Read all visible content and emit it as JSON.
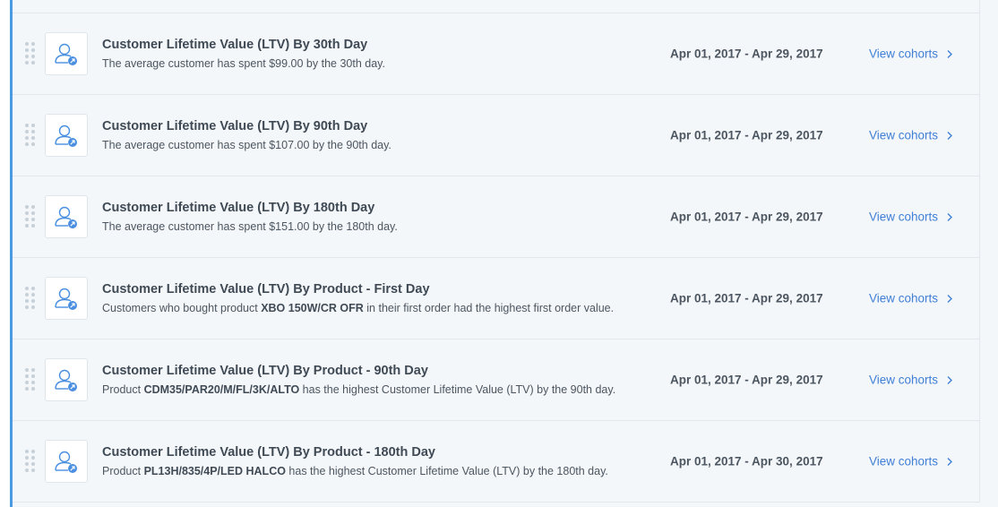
{
  "rows": [
    {
      "title": "Customer Lifetime Value (LTV) By 30th Day",
      "desc_pre": "The average customer has spent $99.00 by the 30th day.",
      "desc_bold": "",
      "desc_post": "",
      "date_range": "Apr 01, 2017 - Apr 29, 2017",
      "link_label": "View cohorts"
    },
    {
      "title": "Customer Lifetime Value (LTV) By 90th Day",
      "desc_pre": "The average customer has spent $107.00 by the 90th day.",
      "desc_bold": "",
      "desc_post": "",
      "date_range": "Apr 01, 2017 - Apr 29, 2017",
      "link_label": "View cohorts"
    },
    {
      "title": "Customer Lifetime Value (LTV) By 180th Day",
      "desc_pre": "The average customer has spent $151.00 by the 180th day.",
      "desc_bold": "",
      "desc_post": "",
      "date_range": "Apr 01, 2017 - Apr 29, 2017",
      "link_label": "View cohorts"
    },
    {
      "title": "Customer Lifetime Value (LTV) By Product - First Day",
      "desc_pre": "Customers who bought product ",
      "desc_bold": "XBO 150W/CR OFR",
      "desc_post": " in their first order had the highest first order value.",
      "date_range": "Apr 01, 2017 - Apr 29, 2017",
      "link_label": "View cohorts"
    },
    {
      "title": "Customer Lifetime Value (LTV) By Product - 90th Day",
      "desc_pre": "Product ",
      "desc_bold": "CDM35/PAR20/M/FL/3K/ALTO",
      "desc_post": " has the highest Customer Lifetime Value (LTV) by the 90th day.",
      "date_range": "Apr 01, 2017 - Apr 29, 2017",
      "link_label": "View cohorts"
    },
    {
      "title": "Customer Lifetime Value (LTV) By Product - 180th Day",
      "desc_pre": "Product ",
      "desc_bold": "PL13H/835/4P/LED HALCO",
      "desc_post": " has the highest Customer Lifetime Value (LTV) by the 180th day.",
      "date_range": "Apr 01, 2017 - Apr 30, 2017",
      "link_label": "View cohorts"
    }
  ],
  "icons": {
    "row_icon": "user-share-icon",
    "drag_handle": "drag-handle-icon",
    "link_chevron": "chevron-right-icon"
  },
  "colors": {
    "accent": "#4a9be0",
    "link": "#3f7fd6",
    "background": "#f4f7fa"
  }
}
